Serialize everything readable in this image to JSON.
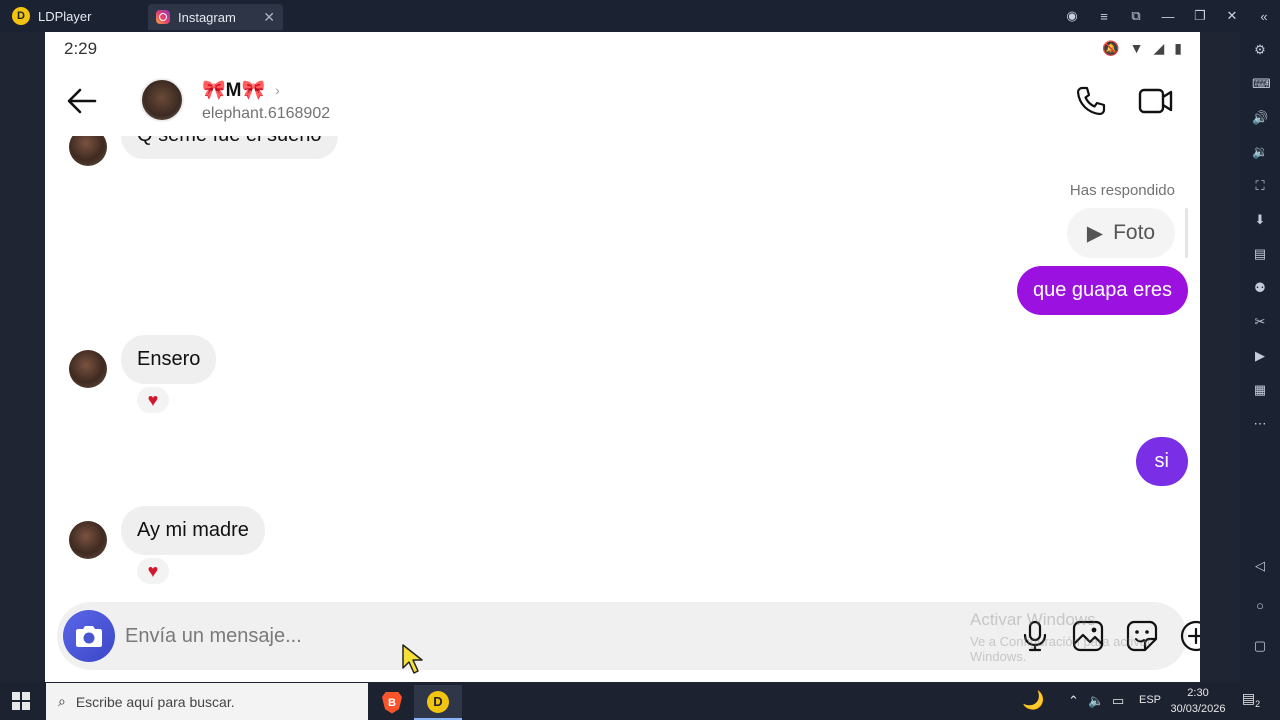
{
  "emulator": {
    "app_title": "LDPlayer",
    "tab_title": "Instagram"
  },
  "status_bar": {
    "time": "2:29"
  },
  "chat": {
    "contact_display": "🎀M🎀",
    "contact_username": "elephant.6168902",
    "partial_message": "Q semé fue el sueño"
  },
  "messages": {
    "replied_label": "Has respondido",
    "replied_media_label": "Foto",
    "sent_1": "que guapa eres",
    "received_1": "Ensero",
    "received_1_reaction": "♥",
    "sent_2": "si",
    "received_2": "Ay mi madre",
    "received_2_reaction": "♥",
    "sent_color": "#9b12e0",
    "sent_color_2": "#7a2ee6"
  },
  "composer": {
    "placeholder": "Envía un mensaje..."
  },
  "watermark": {
    "line1": "Activar Windows",
    "line2": "Ve a Configuración para activar Windows."
  },
  "taskbar": {
    "search_placeholder": "Escribe aquí para buscar.",
    "language": "ESP",
    "clock_time": "2:30",
    "clock_date": "30/03/2026",
    "notification_count": "2"
  }
}
